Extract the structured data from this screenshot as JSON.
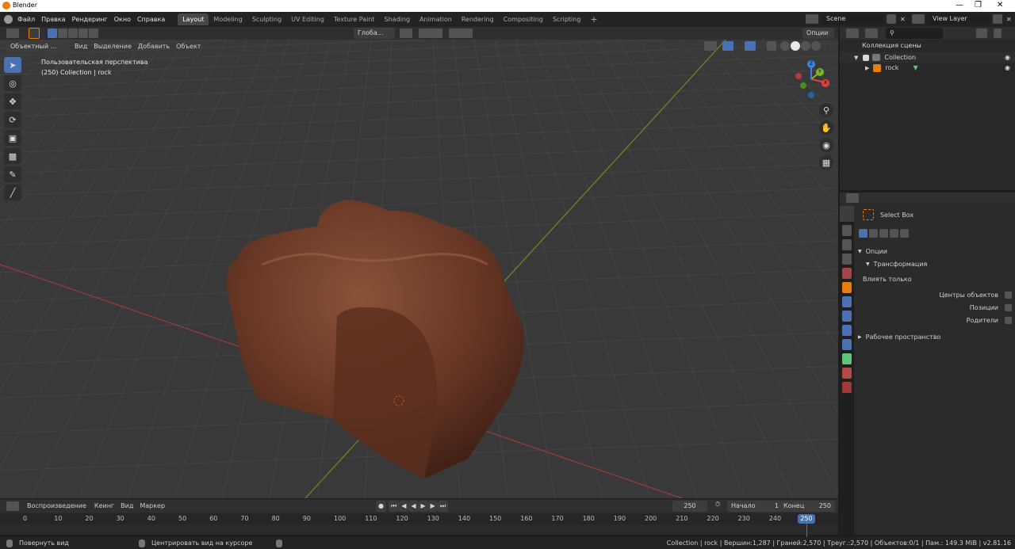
{
  "window": {
    "title": "Blender"
  },
  "menu": [
    "Файл",
    "Правка",
    "Рендеринг",
    "Окно",
    "Справка"
  ],
  "workspaces": [
    "Layout",
    "Modeling",
    "Sculpting",
    "UV Editing",
    "Texture Paint",
    "Shading",
    "Animation",
    "Rendering",
    "Compositing",
    "Scripting"
  ],
  "scene": {
    "name": "Scene",
    "view_layer": "View Layer"
  },
  "viewport": {
    "mode": "Объектный ...",
    "menus": [
      "Вид",
      "Выделение",
      "Добавить",
      "Объект"
    ],
    "orientation": "Глоба...",
    "options": "Опции",
    "perspective": "Пользовательская перспектива",
    "collection_info": "(250) Collection | rock"
  },
  "gizmo": {
    "x": "X",
    "y": "Y",
    "z": "Z"
  },
  "outliner": {
    "root": "Коллекция сцены",
    "collection": "Collection",
    "object": "rock"
  },
  "properties": {
    "tool_name": "Select Box",
    "options_header": "Опции",
    "transform_header": "Трансформация",
    "affect_only": "Влиять только",
    "checkboxes": [
      "Центры объектов",
      "Позиции",
      "Родители"
    ],
    "workspace_header": "Рабочее пространство"
  },
  "timeline": {
    "menus": [
      "Воспроизведение",
      "Кеинг",
      "Вид",
      "Маркер"
    ],
    "current_frame": "250",
    "start_label": "Начало",
    "start_value": "1",
    "end_label": "Конец",
    "end_value": "250",
    "ticks": [
      "0",
      "10",
      "20",
      "30",
      "40",
      "50",
      "60",
      "70",
      "80",
      "90",
      "100",
      "110",
      "120",
      "130",
      "140",
      "150",
      "160",
      "170",
      "180",
      "190",
      "200",
      "210",
      "220",
      "230",
      "240",
      "250"
    ],
    "playhead": "250"
  },
  "status": {
    "left1": "Повернуть вид",
    "left2": "Центрировать вид на курсоре",
    "right": "Collection | rock | Вершин:1,287 | Граней:2,570 | Треуг.:2,570 | Объектов:0/1 | Пам.: 149.3 MiB | v2.81.16"
  },
  "colors": {
    "accent": "#4a72b3",
    "active_orange": "#e87d0d",
    "rock": "#6b3a27"
  }
}
